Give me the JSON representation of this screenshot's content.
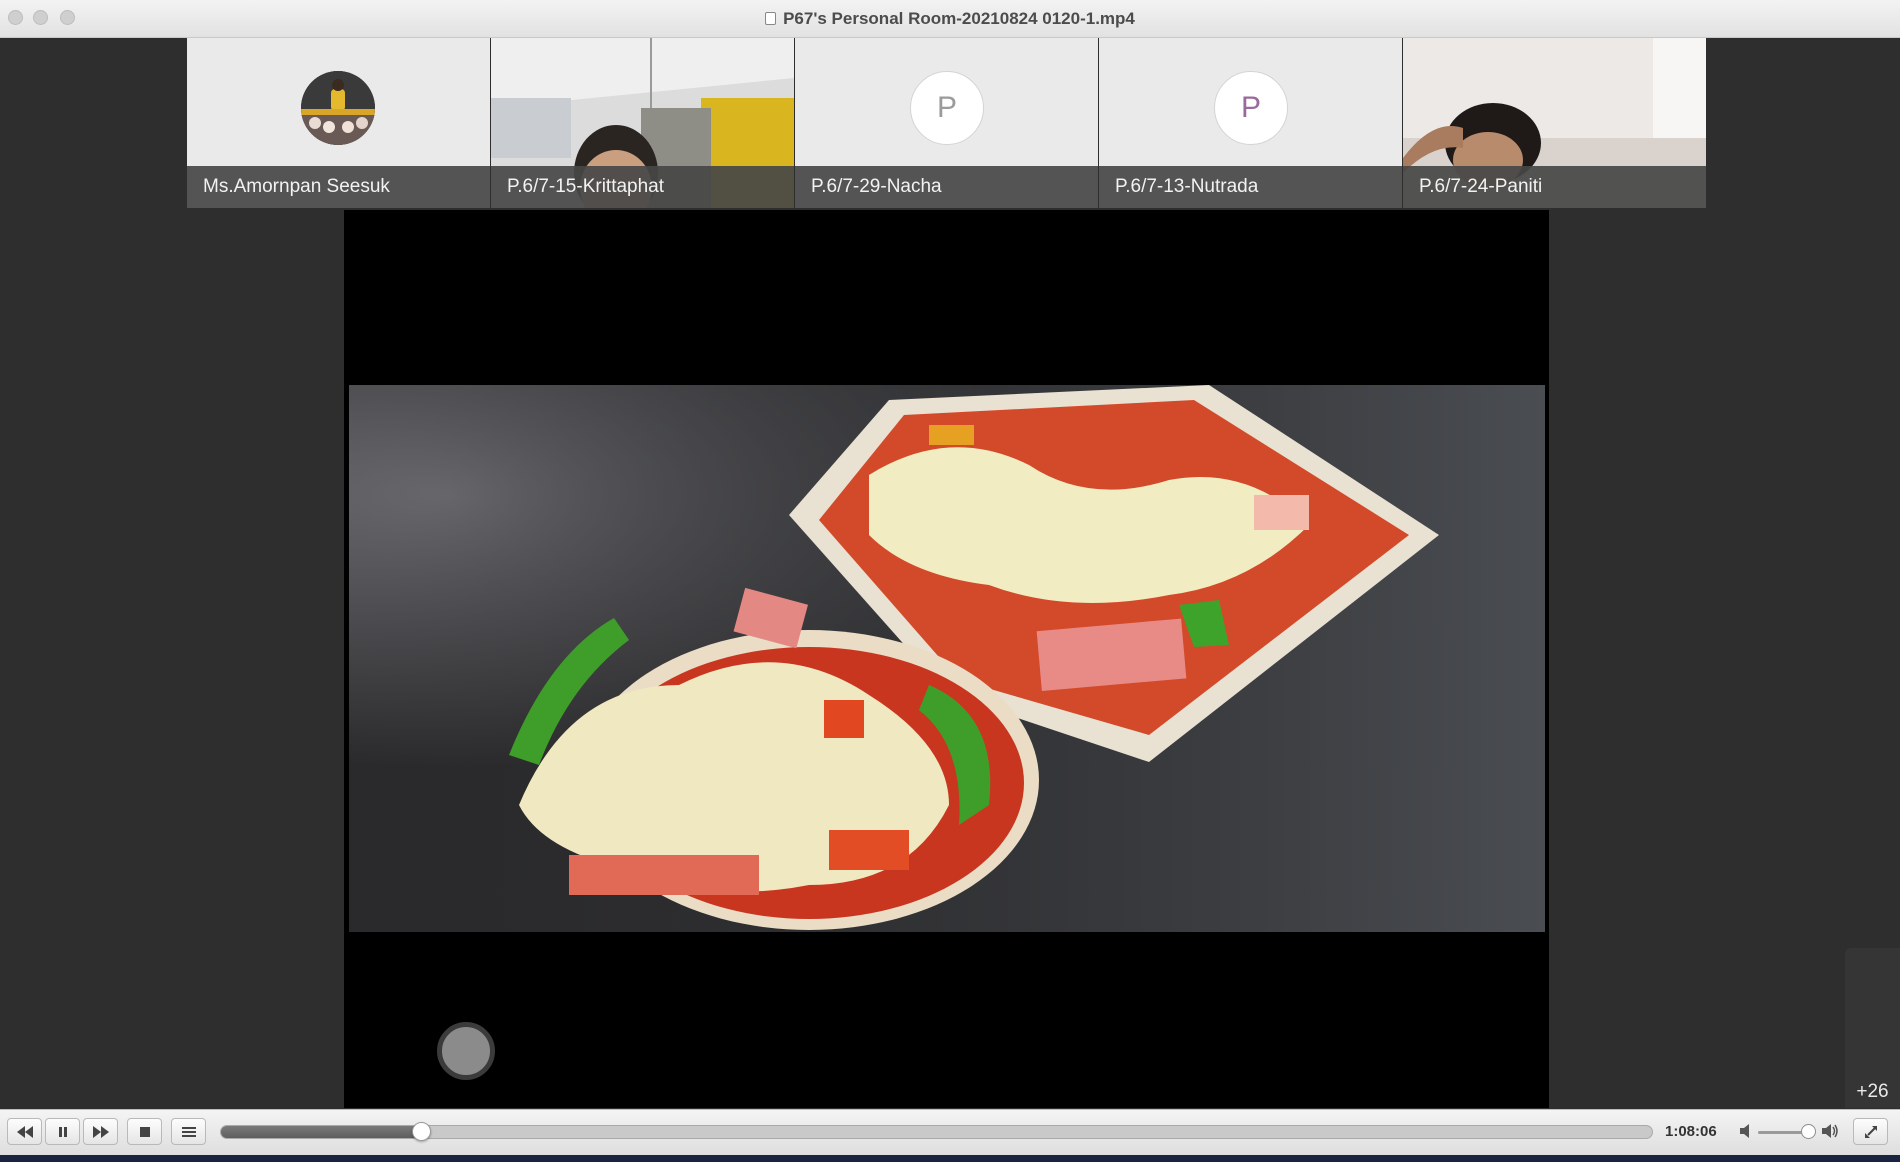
{
  "window": {
    "title": "P67's Personal Room-20210824 0120-1.mp4"
  },
  "participants": [
    {
      "name": "Ms.Amornpan Seesuk",
      "kind": "avatar-photo"
    },
    {
      "name": "P.6/7-15-Krittaphat",
      "kind": "video"
    },
    {
      "name": "P.6/7-29-Nacha",
      "kind": "initial",
      "initial": "P",
      "initial_color": "#9b9b9b"
    },
    {
      "name": "P.6/7-13-Nutrada",
      "kind": "initial",
      "initial": "P",
      "initial_color": "#9a6a9c"
    },
    {
      "name": "P.6/7-24-Paniti",
      "kind": "video"
    }
  ],
  "shared_screen": {
    "content": "photo of two mini pizzas on toast"
  },
  "overflow": {
    "count_label": "+26"
  },
  "player": {
    "state": "playing",
    "time_label": "1:08:06",
    "progress": 0.14,
    "volume": 0.9,
    "buttons": [
      "rewind-icon",
      "pause-icon",
      "fast-forward-icon",
      "stop-icon",
      "playlist-icon",
      "fullscreen-icon"
    ]
  },
  "colors": {
    "recording_indicator": "#ff8a1e",
    "stage_background": "#000000",
    "window_background": "#2e2e2e"
  }
}
